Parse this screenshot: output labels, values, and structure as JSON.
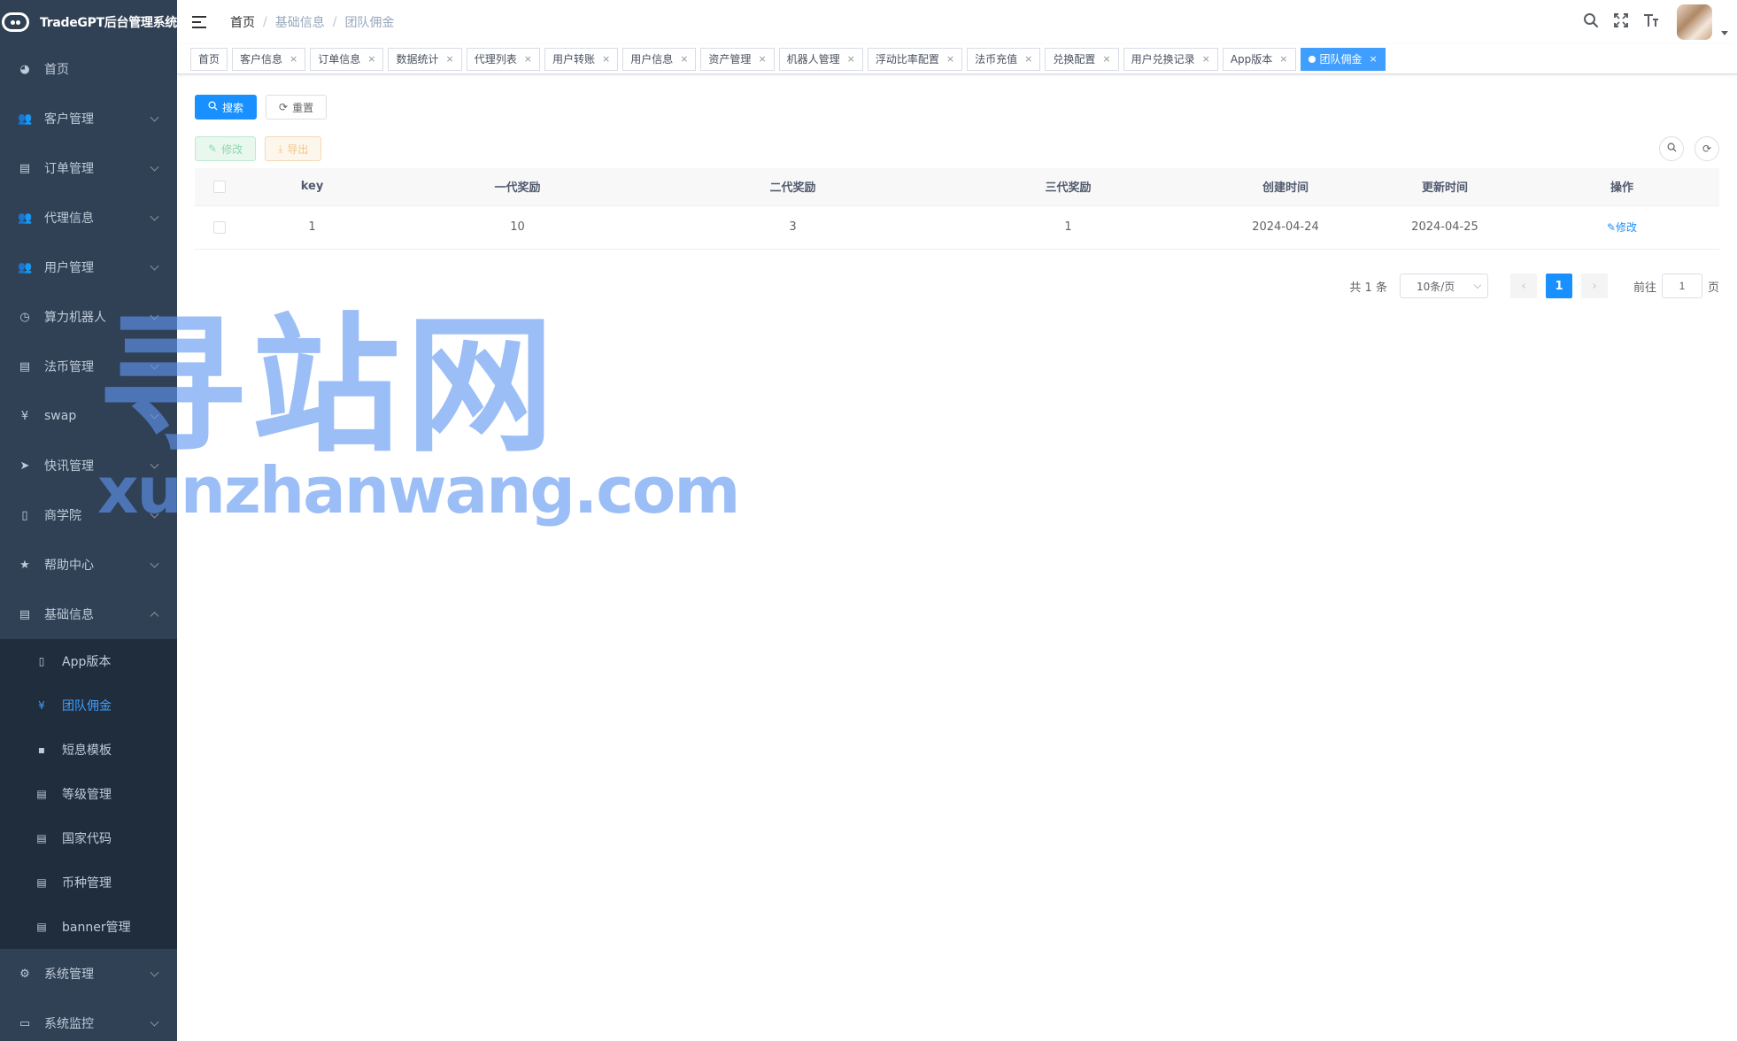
{
  "app": {
    "title": "TradeGPT后台管理系统"
  },
  "sidebar": {
    "items": [
      {
        "label": "首页",
        "icon": "dashboard-icon",
        "glyph": "◕",
        "has_children": false
      },
      {
        "label": "客户管理",
        "icon": "users-icon",
        "glyph": "👥",
        "has_children": true
      },
      {
        "label": "订单管理",
        "icon": "document-icon",
        "glyph": "▤",
        "has_children": true
      },
      {
        "label": "代理信息",
        "icon": "users-icon",
        "glyph": "👥",
        "has_children": true
      },
      {
        "label": "用户管理",
        "icon": "users-icon",
        "glyph": "👥",
        "has_children": true
      },
      {
        "label": "算力机器人",
        "icon": "clock-icon",
        "glyph": "◷",
        "has_children": true
      },
      {
        "label": "法币管理",
        "icon": "document-icon",
        "glyph": "▤",
        "has_children": true
      },
      {
        "label": "swap",
        "icon": "yen-icon",
        "glyph": "¥",
        "has_children": true
      },
      {
        "label": "快讯管理",
        "icon": "send-icon",
        "glyph": "➤",
        "has_children": true
      },
      {
        "label": "商学院",
        "icon": "book-icon",
        "glyph": "▯",
        "has_children": true
      },
      {
        "label": "帮助中心",
        "icon": "star-icon",
        "glyph": "★",
        "has_children": true
      },
      {
        "label": "基础信息",
        "icon": "document-icon",
        "glyph": "▤",
        "has_children": true,
        "expanded": true
      }
    ],
    "sub_items": [
      {
        "label": "App版本",
        "icon": "phone-icon",
        "glyph": "▯"
      },
      {
        "label": "团队佣金",
        "icon": "yen-icon",
        "glyph": "¥",
        "active": true
      },
      {
        "label": "短息模板",
        "icon": "message-icon",
        "glyph": "▪"
      },
      {
        "label": "等级管理",
        "icon": "document-icon",
        "glyph": "▤"
      },
      {
        "label": "国家代码",
        "icon": "document-icon",
        "glyph": "▤"
      },
      {
        "label": "币种管理",
        "icon": "document-icon",
        "glyph": "▤"
      },
      {
        "label": "banner管理",
        "icon": "document-icon",
        "glyph": "▤"
      }
    ],
    "bottom_items": [
      {
        "label": "系统管理",
        "icon": "gear-icon",
        "glyph": "⚙",
        "has_children": true
      },
      {
        "label": "系统监控",
        "icon": "monitor-icon",
        "glyph": "▭",
        "has_children": true
      }
    ]
  },
  "breadcrumb": [
    "首页",
    "基础信息",
    "团队佣金"
  ],
  "header_icons": [
    "search-icon",
    "fullscreen-icon",
    "font-size-icon"
  ],
  "tags": [
    {
      "label": "首页",
      "closable": false
    },
    {
      "label": "客户信息",
      "closable": true
    },
    {
      "label": "订单信息",
      "closable": true
    },
    {
      "label": "数据统计",
      "closable": true
    },
    {
      "label": "代理列表",
      "closable": true
    },
    {
      "label": "用户转账",
      "closable": true
    },
    {
      "label": "用户信息",
      "closable": true
    },
    {
      "label": "资产管理",
      "closable": true
    },
    {
      "label": "机器人管理",
      "closable": true
    },
    {
      "label": "浮动比率配置",
      "closable": true
    },
    {
      "label": "法币充值",
      "closable": true
    },
    {
      "label": "兑换配置",
      "closable": true
    },
    {
      "label": "用户兑换记录",
      "closable": true
    },
    {
      "label": "App版本",
      "closable": true
    },
    {
      "label": "团队佣金",
      "closable": true,
      "active": true
    }
  ],
  "toolbar": {
    "search_label": "搜索",
    "reset_label": "重置",
    "edit_label": "修改",
    "export_label": "导出"
  },
  "table": {
    "columns": [
      "key",
      "一代奖励",
      "二代奖励",
      "三代奖励",
      "创建时间",
      "更新时间",
      "操作"
    ],
    "rows": [
      {
        "key": "1",
        "gen1": "10",
        "gen2": "3",
        "gen3": "1",
        "created": "2024-04-24",
        "updated": "2024-04-25",
        "action": "修改"
      }
    ]
  },
  "pagination": {
    "total_text": "共 1 条",
    "page_size": "10条/页",
    "current_page": "1",
    "goto_prefix": "前往",
    "goto_value": "1",
    "goto_suffix": "页"
  },
  "watermark": {
    "cn": "寻站网",
    "en": "xunzhanwang.com"
  },
  "colors": {
    "sidebar_bg": "#304156",
    "submenu_bg": "#1f2d3d",
    "primary": "#1890ff",
    "active_tag": "#409eff"
  }
}
